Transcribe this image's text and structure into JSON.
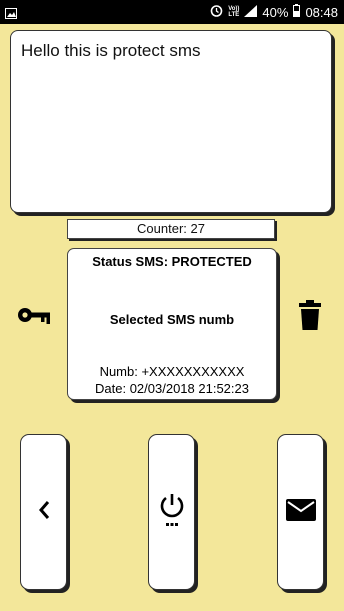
{
  "status_bar": {
    "volte_line1": "Vo))",
    "volte_line2": "LTE",
    "battery": "40%",
    "time": "08:48"
  },
  "message": {
    "text": "Hello this is protect sms"
  },
  "counter": {
    "text": "Counter: 27"
  },
  "status_panel": {
    "title": "Status SMS: PROTECTED",
    "selected": "Selected SMS numb",
    "numb": "Numb: +XXXXXXXXXXX",
    "date": "Date: 02/03/2018 21:52:23"
  },
  "icons": {
    "left": "key-icon",
    "right": "trash-icon",
    "buttons": [
      "chevron-left-icon",
      "power-icon",
      "envelope-icon"
    ]
  },
  "colors": {
    "background": "#f3e79a",
    "card": "#ffffff",
    "status_bar": "#000000"
  }
}
